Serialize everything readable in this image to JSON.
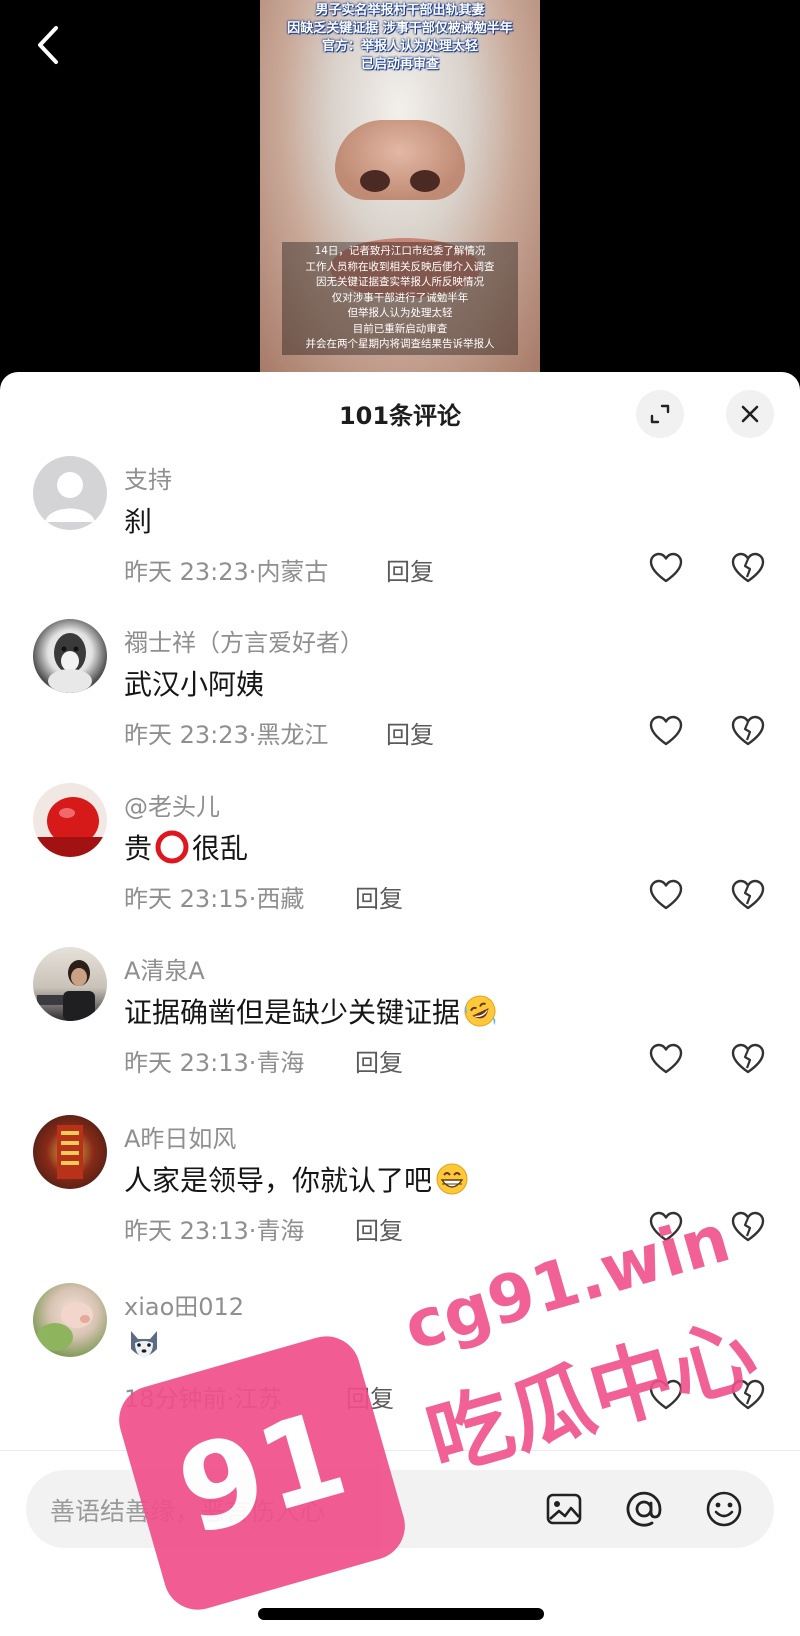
{
  "video": {
    "headline_lines": [
      "男子实名举报村干部出轨其妻",
      "因缺乏关键证据 涉事干部仅被诫勉半年",
      "官方：举报人认为处理太轻",
      "已启动再审查"
    ],
    "subtitle_lines": [
      "14日，记者致丹江口市纪委了解情况",
      "工作人员称在收到相关反映后便介入调查",
      "因无关键证据查实举报人所反映情况",
      "仅对涉事干部进行了诫勉半年",
      "但举报人认为处理太轻",
      "目前已重新启动审查",
      "并会在两个星期内将调查结果告诉举报人"
    ]
  },
  "sheet": {
    "title": "101条评论"
  },
  "comments": [
    {
      "name": "支持",
      "text": "刹",
      "time": "昨天 23:23",
      "location": "内蒙古",
      "reply": "回复",
      "emoji": ""
    },
    {
      "name": "禤士祥（方言爱好者）",
      "text": "武汉小阿姨",
      "time": "昨天 23:23",
      "location": "黑龙江",
      "reply": "回复",
      "emoji": ""
    },
    {
      "name": "@老头儿",
      "text_before": "贵",
      "text_after": "很乱",
      "time": "昨天 23:15",
      "location": "西藏",
      "reply": "回复",
      "emoji": "red-circle"
    },
    {
      "name": "A清泉A",
      "text": "证据确凿但是缺少关键证据",
      "time": "昨天 23:13",
      "location": "青海",
      "reply": "回复",
      "emoji": "rolling-laughing"
    },
    {
      "name": "A昨日如风",
      "text": "人家是领导，你就认了吧",
      "time": "昨天 23:13",
      "location": "青海",
      "reply": "回复",
      "emoji": "grinning"
    },
    {
      "name": "xiao田012",
      "text": "",
      "time": "18分钟前",
      "location": "江苏",
      "reply": "回复",
      "emoji": "wolf"
    }
  ],
  "meta_separator": "·",
  "input": {
    "placeholder": "善语结善缘，恶言伤人心"
  },
  "watermark": {
    "badge": "91",
    "url": "cg91.win",
    "name": "吃瓜中心"
  },
  "colors": {
    "watermark": "#f0508a",
    "caption_outline": "#1a3c8c"
  }
}
